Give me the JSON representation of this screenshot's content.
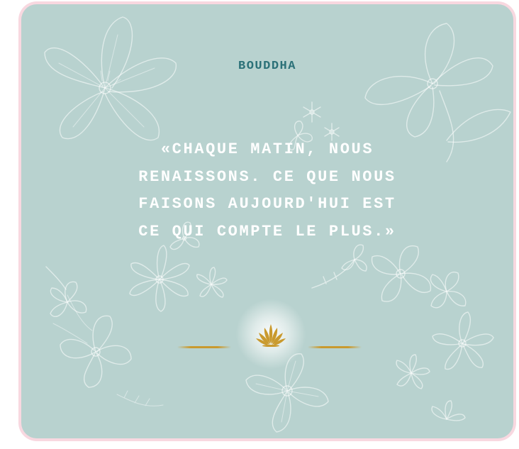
{
  "card": {
    "background_color": "#b8d2cf",
    "frame_color": "#f8d8e0"
  },
  "author": {
    "name": "BOUDDHA",
    "color": "#2b7178"
  },
  "quote": {
    "lines": [
      "«CHAQUE MATIN, NOUS",
      "RENAISSONS. CE QUE NOUS",
      "FAISONS AUJOURD'HUI EST",
      "CE QUI COMPTE LE PLUS.»"
    ],
    "color": "#ffffff"
  },
  "ornament": {
    "icon": "lotus-icon",
    "color": "#c99a2e"
  }
}
